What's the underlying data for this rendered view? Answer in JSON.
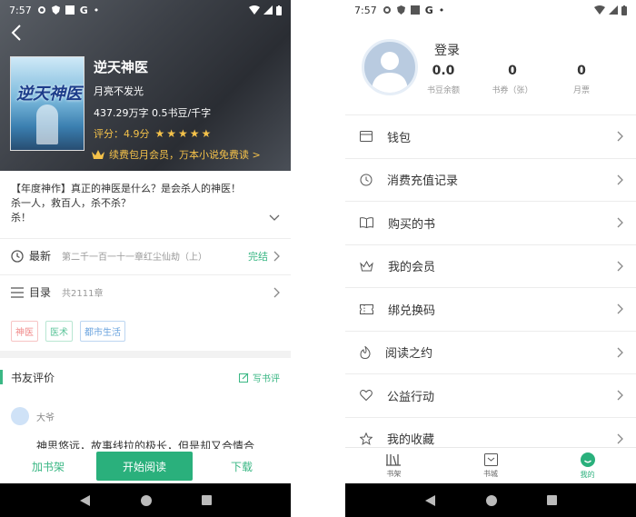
{
  "left": {
    "status": {
      "time": "7:57",
      "g": "G"
    },
    "book": {
      "title": "逆天神医",
      "author": "月亮不发光",
      "stats": "437.29万字 0.5书豆/千字",
      "rating": "评分：4.9分",
      "rating_value": 4.9,
      "stars": "★★★★★",
      "vip": "续费包月会员，万本小说免费读 >",
      "cover_text": "逆天神医"
    },
    "intro": [
      "【年度神作】真正的神医是什么？是会杀人的神医！",
      "杀一人，救百人，杀不杀？",
      "杀！"
    ],
    "latest": {
      "label": "最新",
      "chapter": "第二千一百一十一章红尘仙劫（上）",
      "status": "完结"
    },
    "toc": {
      "label": "目录",
      "count": "共2111章"
    },
    "tags": [
      {
        "text": "神医",
        "color": "#f08a8a"
      },
      {
        "text": "医术",
        "color": "#5cc49a"
      },
      {
        "text": "都市生活",
        "color": "#6aa3de"
      }
    ],
    "reviews": {
      "title": "书友评价",
      "write": "写书评"
    },
    "comment": {
      "name": "大爷",
      "text": "神思悠远，故事线拉的极长，但是却又合情合"
    },
    "actions": {
      "add_shelf": "加书架",
      "read": "开始阅读",
      "download": "下载"
    }
  },
  "right": {
    "status": {
      "time": "7:57",
      "g": "G"
    },
    "profile": {
      "login": "登录",
      "stats": [
        {
          "value": "0.0",
          "label": "书豆余额"
        },
        {
          "value": "0",
          "label": "书券（张）"
        },
        {
          "value": "0",
          "label": "月票"
        }
      ]
    },
    "menu": [
      {
        "label": "钱包",
        "icon": "wallet-icon"
      },
      {
        "label": "消费充值记录",
        "icon": "clock-icon"
      },
      {
        "label": "购买的书",
        "icon": "book-icon"
      },
      {
        "label": "我的会员",
        "icon": "crown-icon"
      },
      {
        "label": "绑兑换码",
        "icon": "ticket-icon"
      },
      {
        "label": "阅读之约",
        "icon": "flame-icon"
      },
      {
        "label": "公益行动",
        "icon": "heart-icon"
      },
      {
        "label": "我的收藏",
        "icon": "star-icon"
      }
    ],
    "tabs": [
      {
        "label": "书架",
        "icon": "bookshelf-icon"
      },
      {
        "label": "书城",
        "icon": "store-icon"
      },
      {
        "label": "我的",
        "icon": "me-icon"
      }
    ],
    "accent": "#2ab07c"
  }
}
